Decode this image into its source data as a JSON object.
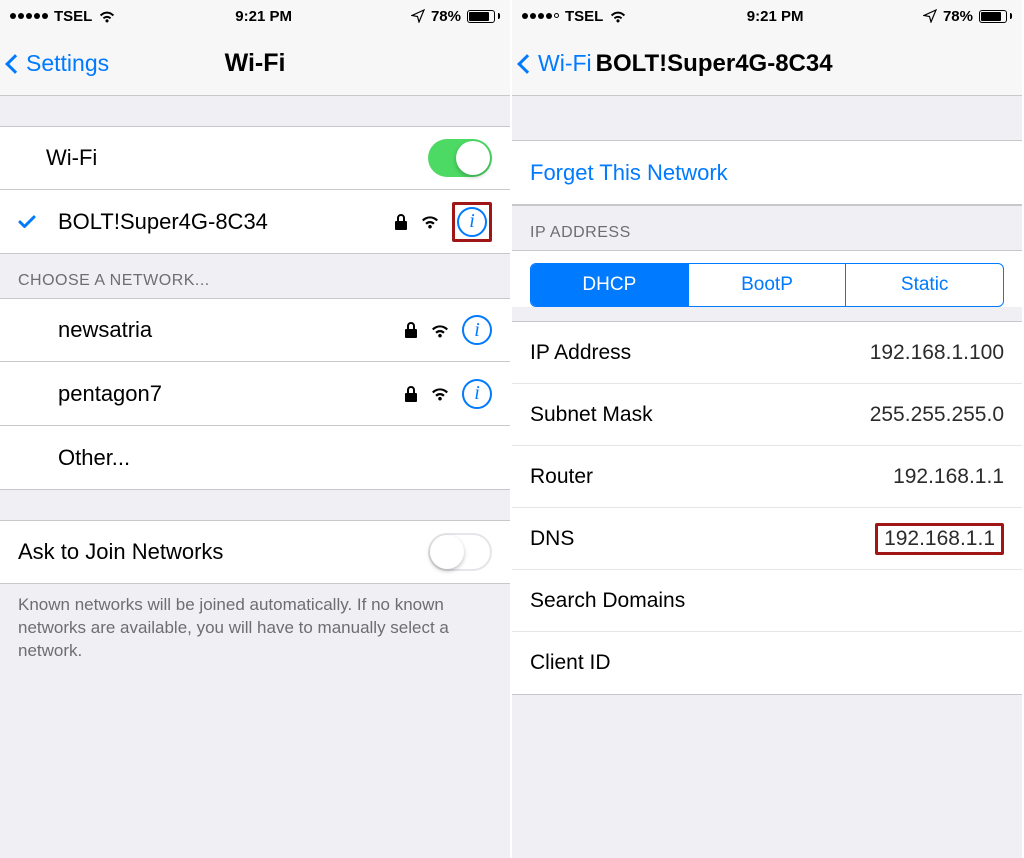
{
  "statusbar": {
    "carrier": "TSEL",
    "time": "9:21 PM",
    "battery_pct": "78%"
  },
  "left": {
    "nav": {
      "back": "Settings",
      "title": "Wi-Fi"
    },
    "wifi_toggle_label": "Wi-Fi",
    "connected": {
      "name": "BOLT!Super4G-8C34"
    },
    "choose_header": "CHOOSE A NETWORK...",
    "networks": [
      {
        "name": "newsatria"
      },
      {
        "name": "pentagon7"
      }
    ],
    "other_label": "Other...",
    "ask_label": "Ask to Join Networks",
    "footnote": "Known networks will be joined automatically. If no known networks are available, you will have to manually select a network."
  },
  "right": {
    "nav": {
      "back": "Wi-Fi",
      "title": "BOLT!Super4G-8C34"
    },
    "forget_label": "Forget This Network",
    "ip_header": "IP ADDRESS",
    "segments": {
      "dhcp": "DHCP",
      "bootp": "BootP",
      "static": "Static"
    },
    "fields": {
      "ip_label": "IP Address",
      "ip_value": "192.168.1.100",
      "mask_label": "Subnet Mask",
      "mask_value": "255.255.255.0",
      "router_label": "Router",
      "router_value": "192.168.1.1",
      "dns_label": "DNS",
      "dns_value": "192.168.1.1",
      "search_label": "Search Domains",
      "search_value": "",
      "client_label": "Client ID",
      "client_value": ""
    }
  }
}
